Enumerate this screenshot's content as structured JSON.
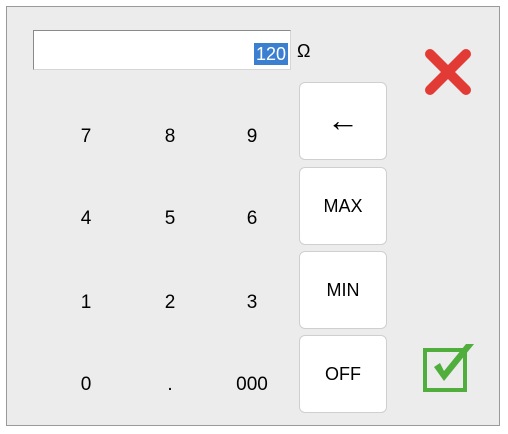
{
  "display": {
    "value": "120",
    "unit": "Ω"
  },
  "keypad": {
    "k7": "7",
    "k8": "8",
    "k9": "9",
    "k4": "4",
    "k5": "5",
    "k6": "6",
    "k1": "1",
    "k2": "2",
    "k3": "3",
    "k0": "0",
    "kdot": ".",
    "k000": "000"
  },
  "functions": {
    "backspace": "←",
    "max": "MAX",
    "min": "MIN",
    "off": "OFF"
  },
  "colors": {
    "close": "#e23b35",
    "ok": "#4fae3c",
    "selection": "#3b7fd1"
  },
  "icons": {
    "close": "close-icon",
    "ok": "checkbox-check-icon"
  }
}
